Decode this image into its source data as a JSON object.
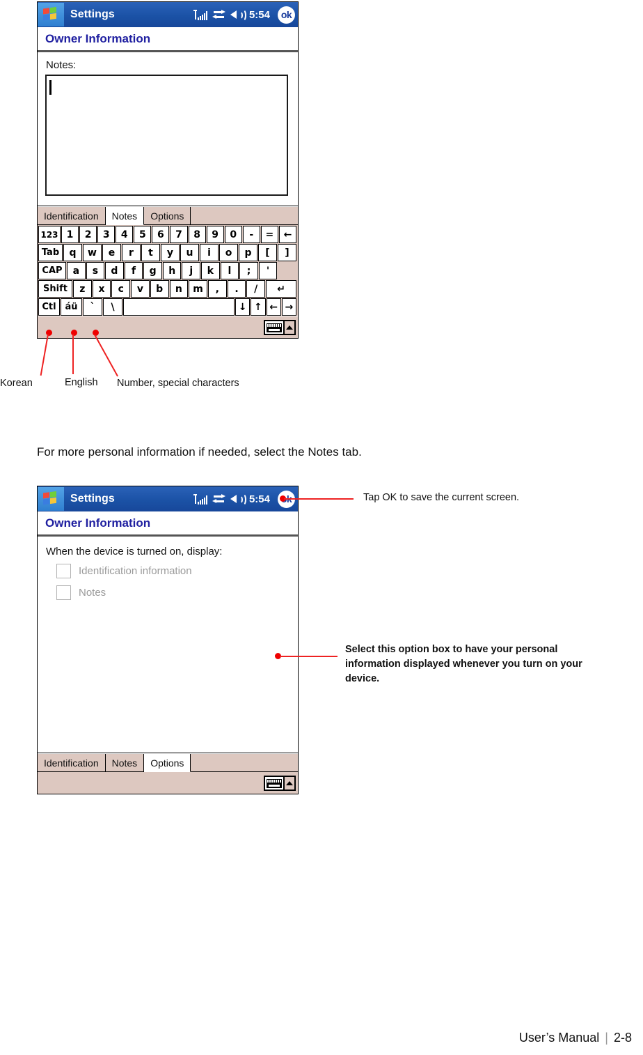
{
  "page": {
    "footer_label": "User’s Manual",
    "footer_separator": "|",
    "footer_page": "2-8",
    "body_text": "For more personal information if needed, select the Notes tab."
  },
  "screen1": {
    "titlebar": {
      "app_title": "Settings",
      "clock": "5:54",
      "ok_label": "ok",
      "icons": [
        "signal-icon",
        "connectivity-icon",
        "speaker-icon"
      ]
    },
    "heading": "Owner Information",
    "notes_label": "Notes:",
    "notes_value": "",
    "tabs": [
      {
        "label": "Identification",
        "active": false
      },
      {
        "label": "Notes",
        "active": true
      },
      {
        "label": "Options",
        "active": false
      }
    ],
    "keyboard": {
      "row1": [
        "123",
        "1",
        "2",
        "3",
        "4",
        "5",
        "6",
        "7",
        "8",
        "9",
        "0",
        "-",
        "=",
        "←"
      ],
      "row2": [
        "Tab",
        "q",
        "w",
        "e",
        "r",
        "t",
        "y",
        "u",
        "i",
        "o",
        "p",
        "[",
        "]"
      ],
      "row3": [
        "CAP",
        "a",
        "s",
        "d",
        "f",
        "g",
        "h",
        "j",
        "k",
        "l",
        ";",
        "'",
        ""
      ],
      "row4": [
        "Shift",
        "z",
        "x",
        "c",
        "v",
        "b",
        "n",
        "m",
        ",",
        ".",
        "/",
        "↵"
      ],
      "row5": [
        "Ctl",
        "áü",
        "`",
        "\\",
        "",
        "↓",
        "↑",
        "←",
        "→"
      ]
    },
    "taskbar": {
      "keyboard_toggle": "keyboard-icon",
      "arrow": "chevron-up-icon"
    },
    "annotations": [
      {
        "label": "Korean"
      },
      {
        "label": "English"
      },
      {
        "label": "Number, special characters"
      }
    ]
  },
  "screen2": {
    "titlebar": {
      "app_title": "Settings",
      "clock": "5:54",
      "ok_label": "ok"
    },
    "heading": "Owner Information",
    "prompt": "When the device is turned on, display:",
    "checkboxes": [
      {
        "label": "Identification information",
        "checked": false
      },
      {
        "label": "Notes",
        "checked": false
      }
    ],
    "tabs": [
      {
        "label": "Identification",
        "active": false
      },
      {
        "label": "Notes",
        "active": false
      },
      {
        "label": "Options",
        "active": true
      }
    ],
    "annotations": [
      {
        "text": "Tap OK to save the current screen."
      },
      {
        "text": "Select this option box to have your personal information displayed whenever you turn on your device."
      }
    ]
  },
  "colors": {
    "titlebar_blue": "#1b52a6",
    "heading_blue": "#1f1fa0",
    "tab_tan": "#ddc8c0",
    "annotation_red": "#ee0000",
    "disabled_gray": "#9a9a9a"
  }
}
